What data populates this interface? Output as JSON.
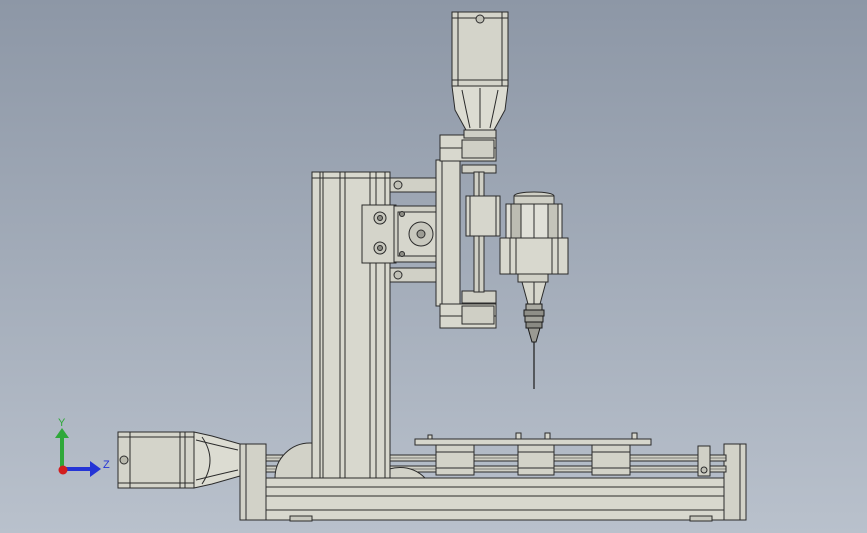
{
  "viewport": {
    "background_top": "#8d97a6",
    "background_bottom": "#b9c1cc"
  },
  "model": {
    "part_fill": "#d6d6cc",
    "part_fill_dark": "#b9b9ad",
    "part_edge": "#2b2b2b",
    "tool_edge": "#1a1a1a"
  },
  "triad": {
    "x_color": "#d21e1e",
    "y_color": "#2fa83a",
    "z_color": "#2434d6",
    "y_label": "Y",
    "z_label": "Z"
  }
}
